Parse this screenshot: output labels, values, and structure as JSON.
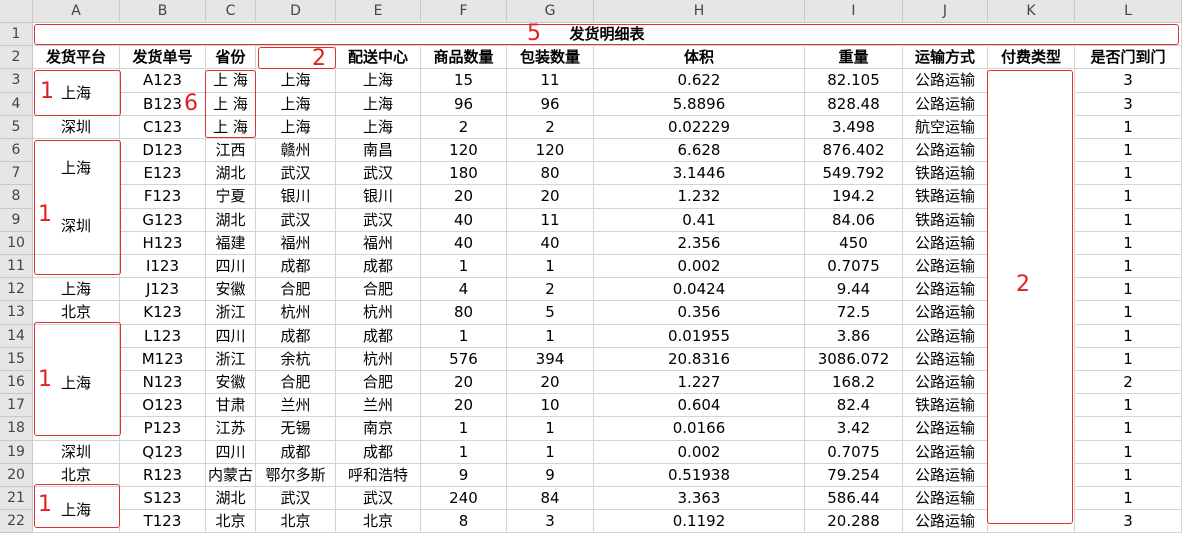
{
  "columns": [
    "A",
    "B",
    "C",
    "D",
    "E",
    "F",
    "G",
    "H",
    "I",
    "J",
    "K",
    "L"
  ],
  "title": "发货明细表",
  "headers": [
    "发货平台",
    "发货单号",
    "省份",
    "",
    "配送中心",
    "商品数量",
    "包装数量",
    "体积",
    "重量",
    "运输方式",
    "付费类型",
    "是否门到门"
  ],
  "rows": [
    {
      "n": "3",
      "a": "上海",
      "b": "A123",
      "c": "上  海",
      "d": "上海",
      "e": "上海",
      "f": "15",
      "g": "11",
      "h": "0.622",
      "i": "82.105",
      "j": "公路运输",
      "k": "",
      "l": "3"
    },
    {
      "n": "4",
      "a": "",
      "b": "B123",
      "c": "上  海",
      "d": "上海",
      "e": "上海",
      "f": "96",
      "g": "96",
      "h": "5.8896",
      "i": "828.48",
      "j": "公路运输",
      "k": "",
      "l": "3"
    },
    {
      "n": "5",
      "a": "深圳",
      "b": "C123",
      "c": "上  海",
      "d": "上海",
      "e": "上海",
      "f": "2",
      "g": "2",
      "h": "0.02229",
      "i": "3.498",
      "j": "航空运输",
      "k": "",
      "l": "1"
    },
    {
      "n": "6",
      "a": "",
      "b": "D123",
      "c": "江西",
      "d": "赣州",
      "e": "南昌",
      "f": "120",
      "g": "120",
      "h": "6.628",
      "i": "876.402",
      "j": "公路运输",
      "k": "",
      "l": "1"
    },
    {
      "n": "7",
      "a": "上海",
      "b": "E123",
      "c": "湖北",
      "d": "武汉",
      "e": "武汉",
      "f": "180",
      "g": "80",
      "h": "3.1446",
      "i": "549.792",
      "j": "铁路运输",
      "k": "",
      "l": "1"
    },
    {
      "n": "8",
      "a": "",
      "b": "F123",
      "c": "宁夏",
      "d": "银川",
      "e": "银川",
      "f": "20",
      "g": "20",
      "h": "1.232",
      "i": "194.2",
      "j": "铁路运输",
      "k": "",
      "l": "1"
    },
    {
      "n": "9",
      "a": "",
      "b": "G123",
      "c": "湖北",
      "d": "武汉",
      "e": "武汉",
      "f": "40",
      "g": "11",
      "h": "0.41",
      "i": "84.06",
      "j": "铁路运输",
      "k": "",
      "l": "1"
    },
    {
      "n": "10",
      "a": "深圳",
      "b": "H123",
      "c": "福建",
      "d": "福州",
      "e": "福州",
      "f": "40",
      "g": "40",
      "h": "2.356",
      "i": "450",
      "j": "公路运输",
      "k": "",
      "l": "1"
    },
    {
      "n": "11",
      "a": "",
      "b": "I123",
      "c": "四川",
      "d": "成都",
      "e": "成都",
      "f": "1",
      "g": "1",
      "h": "0.002",
      "i": "0.7075",
      "j": "公路运输",
      "k": "",
      "l": "1"
    },
    {
      "n": "12",
      "a": "上海",
      "b": "J123",
      "c": "安徽",
      "d": "合肥",
      "e": "合肥",
      "f": "4",
      "g": "2",
      "h": "0.0424",
      "i": "9.44",
      "j": "公路运输",
      "k": "",
      "l": "1"
    },
    {
      "n": "13",
      "a": "北京",
      "b": "K123",
      "c": "浙江",
      "d": "杭州",
      "e": "杭州",
      "f": "80",
      "g": "5",
      "h": "0.356",
      "i": "72.5",
      "j": "公路运输",
      "k": "",
      "l": "1"
    },
    {
      "n": "14",
      "a": "",
      "b": "L123",
      "c": "四川",
      "d": "成都",
      "e": "成都",
      "f": "1",
      "g": "1",
      "h": "0.01955",
      "i": "3.86",
      "j": "公路运输",
      "k": "",
      "l": "1"
    },
    {
      "n": "15",
      "a": "",
      "b": "M123",
      "c": "浙江",
      "d": "余杭",
      "e": "杭州",
      "f": "576",
      "g": "394",
      "h": "20.8316",
      "i": "3086.072",
      "j": "公路运输",
      "k": "",
      "l": "1"
    },
    {
      "n": "16",
      "a": "上海",
      "b": "N123",
      "c": "安徽",
      "d": "合肥",
      "e": "合肥",
      "f": "20",
      "g": "20",
      "h": "1.227",
      "i": "168.2",
      "j": "公路运输",
      "k": "",
      "l": "2"
    },
    {
      "n": "17",
      "a": "",
      "b": "O123",
      "c": "甘肃",
      "d": "兰州",
      "e": "兰州",
      "f": "20",
      "g": "10",
      "h": "0.604",
      "i": "82.4",
      "j": "铁路运输",
      "k": "",
      "l": "1"
    },
    {
      "n": "18",
      "a": "",
      "b": "P123",
      "c": "江苏",
      "d": "无锡",
      "e": "南京",
      "f": "1",
      "g": "1",
      "h": "0.0166",
      "i": "3.42",
      "j": "公路运输",
      "k": "",
      "l": "1"
    },
    {
      "n": "19",
      "a": "深圳",
      "b": "Q123",
      "c": "四川",
      "d": "成都",
      "e": "成都",
      "f": "1",
      "g": "1",
      "h": "0.002",
      "i": "0.7075",
      "j": "公路运输",
      "k": "",
      "l": "1"
    },
    {
      "n": "20",
      "a": "北京",
      "b": "R123",
      "c": "内蒙古",
      "d": "鄂尔多斯",
      "e": "呼和浩特",
      "f": "9",
      "g": "9",
      "h": "0.51938",
      "i": "79.254",
      "j": "公路运输",
      "k": "",
      "l": "1"
    },
    {
      "n": "21",
      "a": "上海",
      "b": "S123",
      "c": "湖北",
      "d": "武汉",
      "e": "武汉",
      "f": "240",
      "g": "84",
      "h": "3.363",
      "i": "586.44",
      "j": "公路运输",
      "k": "",
      "l": "1"
    },
    {
      "n": "22",
      "a": "",
      "b": "T123",
      "c": "北京",
      "d": "北京",
      "e": "北京",
      "f": "8",
      "g": "3",
      "h": "0.1192",
      "i": "20.288",
      "j": "公路运输",
      "k": "",
      "l": "3"
    }
  ],
  "annotations": [
    {
      "text": "5",
      "color": "#e02020"
    },
    {
      "text": "2",
      "color": "#e02020"
    },
    {
      "text": "1",
      "color": "#e02020"
    },
    {
      "text": "6",
      "color": "#e02020"
    },
    {
      "text": "1",
      "color": "#e02020"
    },
    {
      "text": "2",
      "color": "#e02020"
    },
    {
      "text": "1",
      "color": "#e02020"
    },
    {
      "text": "1",
      "color": "#e02020"
    }
  ]
}
